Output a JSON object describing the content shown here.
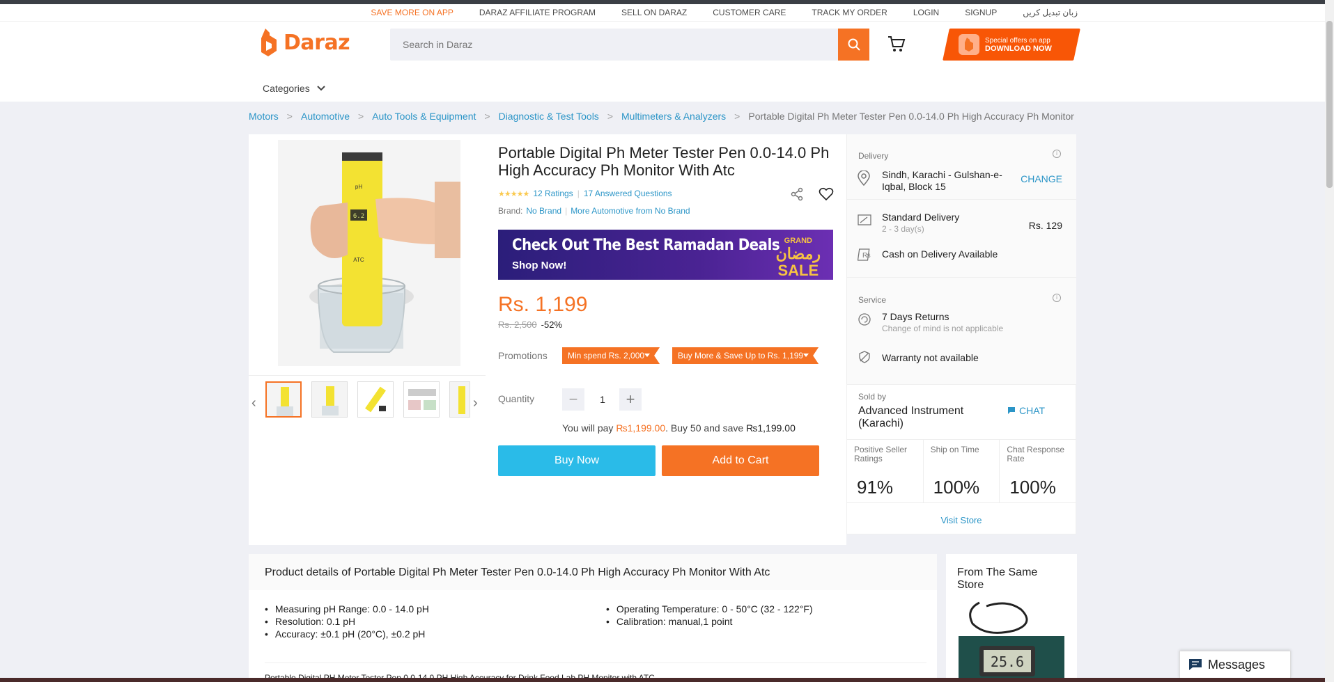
{
  "toplinks": [
    "SAVE MORE ON APP",
    "DARAZ AFFILIATE PROGRAM",
    "SELL ON DARAZ",
    "CUSTOMER CARE",
    "TRACK MY ORDER",
    "LOGIN",
    "SIGNUP",
    "زبان تبدیل کریں"
  ],
  "header": {
    "logo_text": "Daraz",
    "search_placeholder": "Search in Daraz",
    "app_banner_line1": "Special offers on app",
    "app_banner_line2": "DOWNLOAD NOW",
    "categories_label": "Categories"
  },
  "breadcrumb": [
    "Motors",
    "Automotive",
    "Auto Tools & Equipment",
    "Diagnostic & Test Tools",
    "Multimeters & Analyzers"
  ],
  "breadcrumb_current": "Portable Digital Ph Meter Tester Pen 0.0-14.0 Ph High Accuracy Ph Monitor",
  "product": {
    "title": "Portable Digital Ph Meter Tester Pen 0.0-14.0 Ph High Accuracy Ph Monitor With Atc",
    "stars": "★★★★★",
    "ratings": "12 Ratings",
    "answered": "17 Answered Questions",
    "brand_label": "Brand:",
    "brand": "No Brand",
    "more_from": "More Automotive from No Brand",
    "banner_headline": "Check Out The Best Ramadan Deals",
    "banner_sub": "Shop Now!",
    "banner_grand": "GRAND",
    "banner_arabic": "رمضان",
    "banner_sale": "SALE",
    "price": "Rs. 1,199",
    "old_price": "Rs. 2,500",
    "discount": "-52%",
    "promotions_label": "Promotions",
    "promo_tags": [
      "Min spend Rs. 2,000",
      "Buy More & Save Up to Rs. 1,199"
    ],
    "quantity_label": "Quantity",
    "quantity": "1",
    "you_pay_prefix": "You will pay ",
    "you_pay_amount": "₨1,199.00",
    "you_pay_mid": ". Buy 50 and save ",
    "you_pay_save": "₨1,199.00",
    "buy_now": "Buy Now",
    "add_to_cart": "Add to Cart",
    "lcd_reading": "6.2"
  },
  "delivery": {
    "title": "Delivery",
    "location": "Sindh, Karachi - Gulshan-e-Iqbal, Block 15",
    "change": "CHANGE",
    "standard": "Standard Delivery",
    "standard_days": "2 - 3 day(s)",
    "standard_price": "Rs. 129",
    "cod": "Cash on Delivery Available",
    "service_title": "Service",
    "returns": "7 Days Returns",
    "returns_sub": "Change of mind is not applicable",
    "warranty": "Warranty not available"
  },
  "seller": {
    "sold_by": "Sold by",
    "name": "Advanced Instrument (Karachi)",
    "chat": "CHAT",
    "metrics": [
      {
        "label": "Positive Seller Ratings",
        "value": "91%"
      },
      {
        "label": "Ship on Time",
        "value": "100%"
      },
      {
        "label": "Chat Response Rate",
        "value": "100%"
      }
    ],
    "visit": "Visit Store"
  },
  "details": {
    "heading": "Product details of Portable Digital Ph Meter Tester Pen 0.0-14.0 Ph High Accuracy Ph Monitor With Atc",
    "left": [
      "Measuring pH Range: 0.0 - 14.0 pH",
      "Resolution: 0.1 pH",
      "Accuracy: ±0.1 pH (20°C), ±0.2 pH"
    ],
    "right": [
      "Operating Temperature: 0 - 50°C (32 - 122°F)",
      "Calibration: manual,1 point"
    ],
    "desc": "Portable Digital PH Meter Tester Pen 0.0-14.0 PH High Accuracy for Drink Food Lab PH Monitor with ATC"
  },
  "same_store": {
    "heading": "From The Same Store",
    "thumb_reading": "25.6"
  },
  "messages": "Messages",
  "colors": {
    "accent": "#f57224",
    "link": "#2b95c7",
    "buy": "#2abbe8"
  }
}
